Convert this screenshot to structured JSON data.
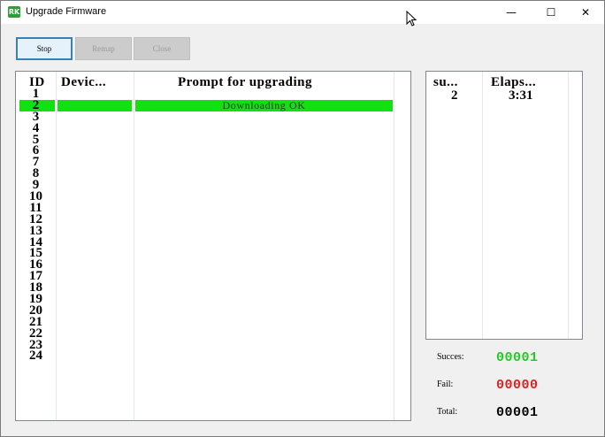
{
  "window": {
    "title": "Upgrade Firmware",
    "app_icon_text": "RK",
    "controls": {
      "minimize": "—",
      "maximize": "☐",
      "close": "✕"
    }
  },
  "toolbar": {
    "stop_label": "Stop",
    "remap_label": "Remap",
    "close_label": "Close"
  },
  "device_list": {
    "headers": {
      "id": "ID",
      "device": "Devic...",
      "prompt": "Prompt for upgrading"
    },
    "ids": [
      "1",
      "2",
      "3",
      "4",
      "5",
      "6",
      "7",
      "8",
      "9",
      "10",
      "11",
      "12",
      "13",
      "14",
      "15",
      "16",
      "17",
      "18",
      "19",
      "20",
      "21",
      "22",
      "23",
      "24"
    ],
    "selected_index": 2,
    "selected_prompt": "Downloading OK",
    "highlight_color": "#11e011"
  },
  "status_list": {
    "headers": {
      "success": "su...",
      "elapsed": "Elaps..."
    },
    "rows": [
      {
        "success": "2",
        "elapsed": "3:31"
      }
    ]
  },
  "stats": {
    "success_label": "Succes:",
    "success_value": "00001",
    "success_color": "#22cc22",
    "fail_label": "Fail:",
    "fail_value": "00000",
    "fail_color": "#dd2222",
    "total_label": "Total:",
    "total_value": "00001",
    "total_color": "#000000"
  }
}
